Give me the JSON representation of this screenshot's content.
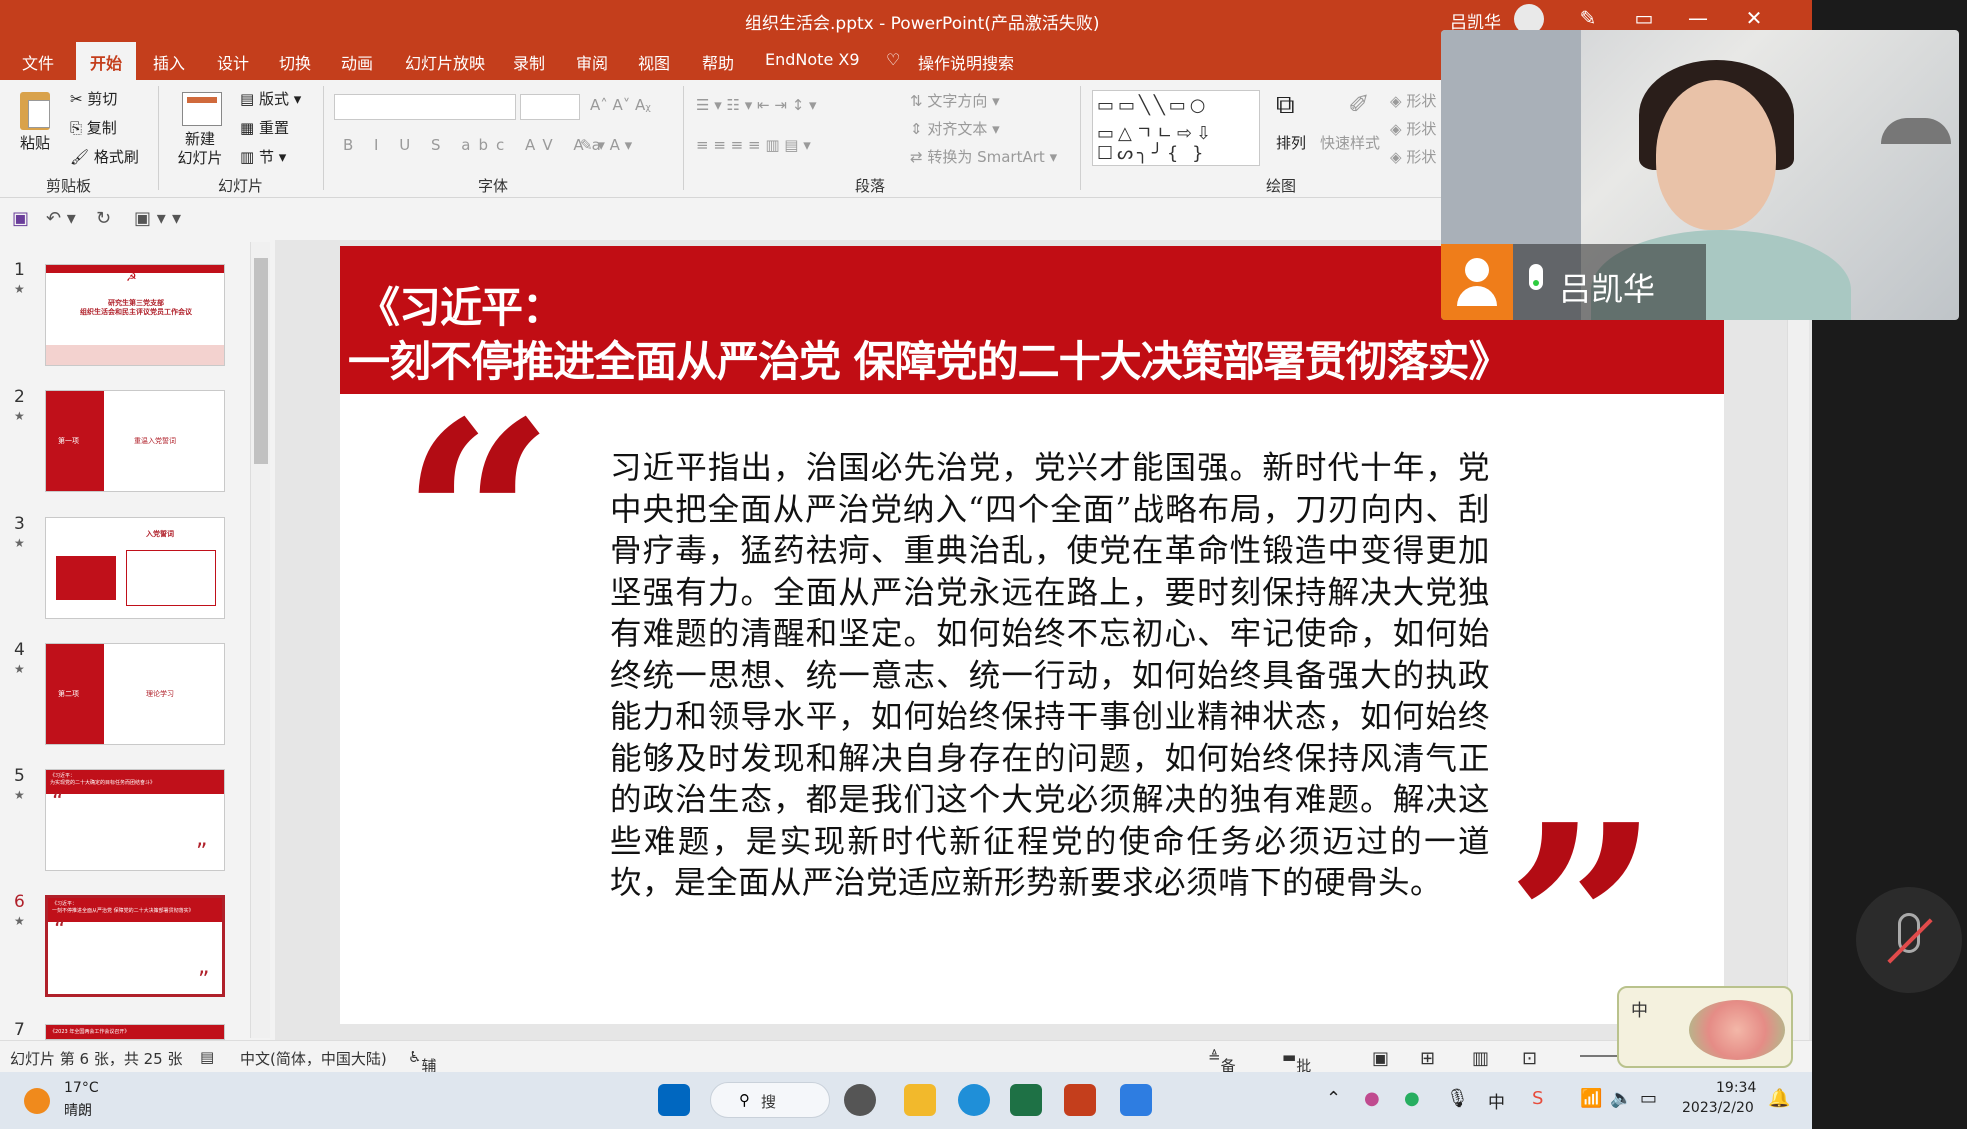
{
  "titlebar": {
    "title": "组织生活会.pptx  -  PowerPoint(产品激活失败)",
    "user": "吕凯华"
  },
  "tabs": [
    "文件",
    "开始",
    "插入",
    "设计",
    "切换",
    "动画",
    "幻灯片放映",
    "录制",
    "审阅",
    "视图",
    "帮助",
    "EndNote X9",
    "操作说明搜索"
  ],
  "ribbon": {
    "clipboard": {
      "paste": "粘贴",
      "cut": "剪切",
      "copy": "复制",
      "format_painter": "格式刷",
      "group": "剪贴板"
    },
    "slides": {
      "new_slide": "新建\n幻灯片",
      "layout": "版式",
      "reset": "重置",
      "section": "节",
      "group": "幻灯片"
    },
    "font": {
      "group": "字体"
    },
    "paragraph": {
      "text_direction": "文字方向",
      "align_text": "对齐文本",
      "smartart": "转换为 SmartArt",
      "group": "段落"
    },
    "drawing": {
      "arrange": "排列",
      "quick_styles": "快速样式",
      "shape1": "形状",
      "shape2": "形状",
      "shape3": "形状",
      "group": "绘图"
    }
  },
  "thumbnails": [
    {
      "num": "1",
      "text": "研究生第三党支部\n组织生活会和民主评议党员工作会议"
    },
    {
      "num": "2",
      "text": "重温入党誓词",
      "label": "第一项"
    },
    {
      "num": "3",
      "text": "入党誓词"
    },
    {
      "num": "4",
      "text": "理论学习",
      "label": "第二项"
    },
    {
      "num": "5",
      "text": "《习近平：\n为实现党的二十大确定的目标任务而团结奋斗》"
    },
    {
      "num": "6",
      "text": "《习近平：\n一刻不停推进全面从严治党 保障党的二十大决策部署贯彻落实》"
    },
    {
      "num": "7",
      "text": "《2023 年全国两会工作会议召开》"
    }
  ],
  "slide": {
    "title_line1": "《习近平：",
    "title_line2": "一刻不停推进全面从严治党 保障党的二十大决策部署贯彻落实》",
    "open_quote": "“",
    "close_quote": "”",
    "body": "习近平指出，治国必先治党，党兴才能国强。新时代十年，党中央把全面从严治党纳入“四个全面”战略布局，刀刃向内、刮骨疗毒，猛药祛疴、重典治乱，使党在革命性锻造中变得更加坚强有力。全面从严治党永远在路上，要时刻保持解决大党独有难题的清醒和坚定。如何始终不忘初心、牢记使命，如何始终统一思想、统一意志、统一行动，如何始终具备强大的执政能力和领导水平，如何始终保持干事创业精神状态，如何始终能够及时发现和解决自身存在的问题，如何始终保持风清气正的政治生态，都是我们这个大党必须解决的独有难题。解决这些难题，是实现新时代新征程党的使命任务必须迈过的一道坎，是全面从严治党适应新形势新要求必须啃下的硬骨头。"
  },
  "status": {
    "slide_info": "幻灯片 第 6 张，共 25 张",
    "language": "中文(简体，中国大陆)",
    "accessibility": "辅助功能: 调查",
    "notes": "备注",
    "comments": "批注"
  },
  "taskbar": {
    "temp": "17°C",
    "weather": "晴朗",
    "search": "搜",
    "time": "19:34",
    "date": "2023/2/20",
    "ime_indicator": "中"
  },
  "video": {
    "name": "吕凯华"
  },
  "ime_popup": {
    "label": "中"
  },
  "colors": {
    "ppt_red": "#c43e1c",
    "slide_red": "#c10d14",
    "quote_red": "#b30c14"
  }
}
